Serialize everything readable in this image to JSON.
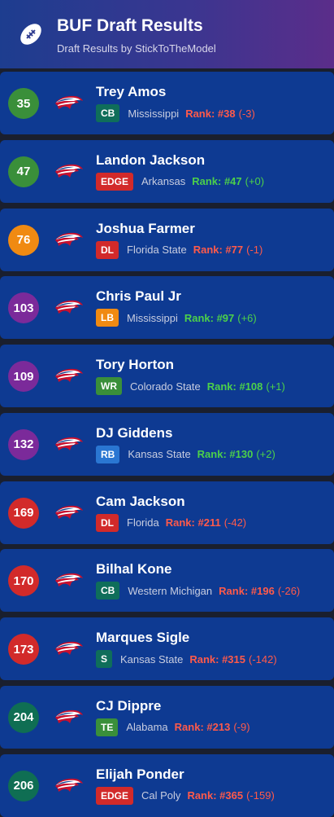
{
  "header": {
    "title": "BUF Draft Results",
    "subtitle": "Draft Results by StickToTheModel",
    "icon": "football-icon"
  },
  "colors": {
    "pick_green": "#3a8f3a",
    "pick_orange": "#f08a12",
    "pick_purple": "#7b2a9a",
    "pick_red": "#d22a2a",
    "pick_teal": "#0f6e53",
    "rank_bad": "#ff5a4a",
    "rank_good": "#4cd04a"
  },
  "picks": [
    {
      "pick": "35",
      "name": "Trey Amos",
      "pos": "CB",
      "school": "Mississippi",
      "rank": "Rank: #38",
      "delta": "(-3)",
      "good": false,
      "pick_color": "#3a8f3a",
      "pos_color": "#0f6e5a"
    },
    {
      "pick": "47",
      "name": "Landon Jackson",
      "pos": "EDGE",
      "school": "Arkansas",
      "rank": "Rank: #47",
      "delta": "(+0)",
      "good": true,
      "pick_color": "#3a8f3a",
      "pos_color": "#d22a2a"
    },
    {
      "pick": "76",
      "name": "Joshua Farmer",
      "pos": "DL",
      "school": "Florida State",
      "rank": "Rank: #77",
      "delta": "(-1)",
      "good": false,
      "pick_color": "#f08a12",
      "pos_color": "#d22a2a"
    },
    {
      "pick": "103",
      "name": "Chris Paul Jr",
      "pos": "LB",
      "school": "Mississippi",
      "rank": "Rank: #97",
      "delta": "(+6)",
      "good": true,
      "pick_color": "#7b2a9a",
      "pos_color": "#f08a12"
    },
    {
      "pick": "109",
      "name": "Tory Horton",
      "pos": "WR",
      "school": "Colorado State",
      "rank": "Rank: #108",
      "delta": "(+1)",
      "good": true,
      "pick_color": "#7b2a9a",
      "pos_color": "#3a8f3a"
    },
    {
      "pick": "132",
      "name": "DJ Giddens",
      "pos": "RB",
      "school": "Kansas State",
      "rank": "Rank: #130",
      "delta": "(+2)",
      "good": true,
      "pick_color": "#7b2a9a",
      "pos_color": "#2a76d2"
    },
    {
      "pick": "169",
      "name": "Cam Jackson",
      "pos": "DL",
      "school": "Florida",
      "rank": "Rank: #211",
      "delta": "(-42)",
      "good": false,
      "pick_color": "#d22a2a",
      "pos_color": "#d22a2a"
    },
    {
      "pick": "170",
      "name": "Bilhal Kone",
      "pos": "CB",
      "school": "Western Michigan",
      "rank": "Rank: #196",
      "delta": "(-26)",
      "good": false,
      "pick_color": "#d22a2a",
      "pos_color": "#0f6e5a"
    },
    {
      "pick": "173",
      "name": "Marques Sigle",
      "pos": "S",
      "school": "Kansas State",
      "rank": "Rank: #315",
      "delta": "(-142)",
      "good": false,
      "pick_color": "#d22a2a",
      "pos_color": "#0f6e5a"
    },
    {
      "pick": "204",
      "name": "CJ Dippre",
      "pos": "TE",
      "school": "Alabama",
      "rank": "Rank: #213",
      "delta": "(-9)",
      "good": false,
      "pick_color": "#0f6e53",
      "pos_color": "#3a8f3a"
    },
    {
      "pick": "206",
      "name": "Elijah Ponder",
      "pos": "EDGE",
      "school": "Cal Poly",
      "rank": "Rank: #365",
      "delta": "(-159)",
      "good": false,
      "pick_color": "#0f6e53",
      "pos_color": "#d22a2a"
    }
  ]
}
